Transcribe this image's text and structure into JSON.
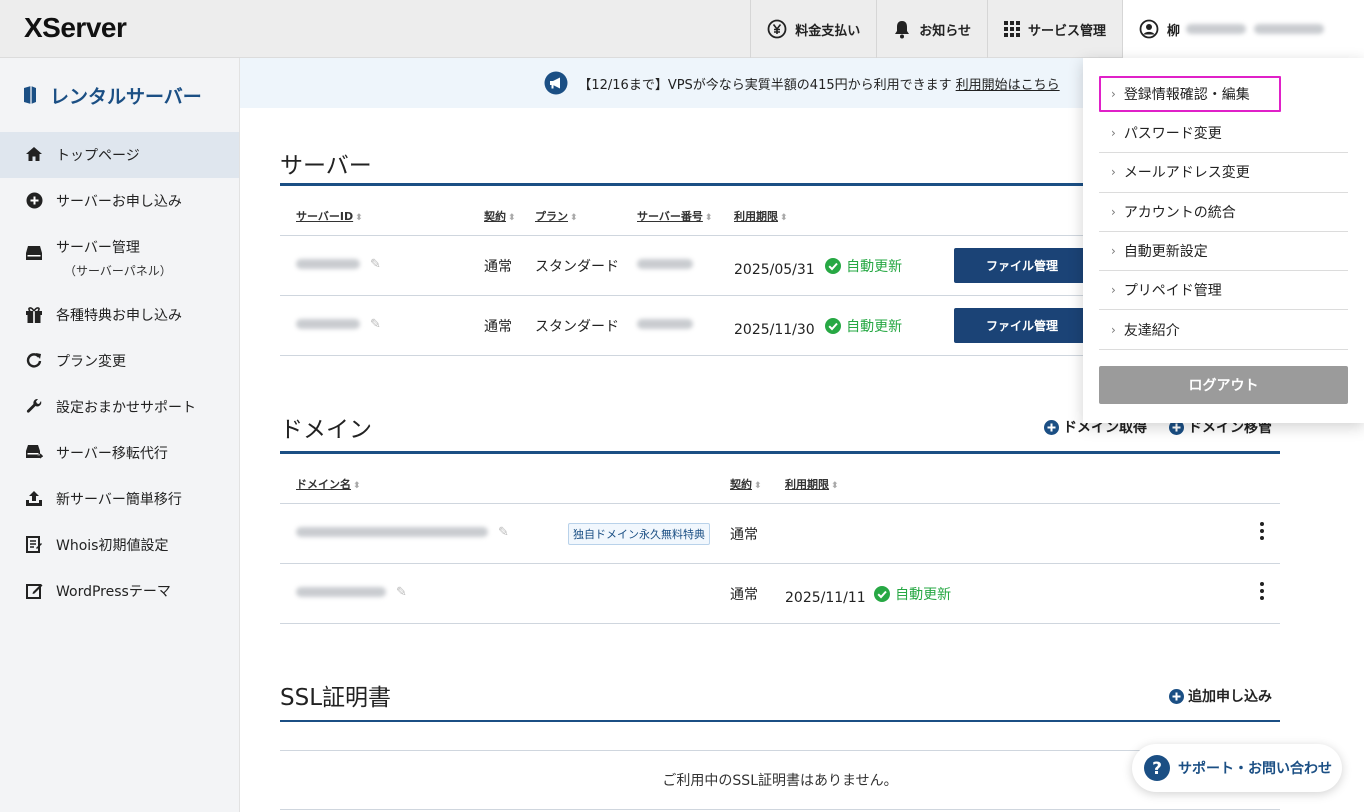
{
  "header": {
    "logo": "XServer",
    "nav": [
      {
        "label": "料金支払い",
        "icon": "yen-icon"
      },
      {
        "label": "お知らせ",
        "icon": "bell-icon"
      },
      {
        "label": "サービス管理",
        "icon": "grid-icon"
      }
    ],
    "user_initial": "柳"
  },
  "sidebar": {
    "title": "レンタルサーバー",
    "items": [
      {
        "label": "トップページ",
        "icon": "home-icon"
      },
      {
        "label": "サーバーお申し込み",
        "icon": "plus-circle-icon"
      },
      {
        "label": "サーバー管理",
        "sub": "（サーバーパネル）",
        "icon": "server-icon"
      },
      {
        "label": "各種特典お申し込み",
        "icon": "gift-icon"
      },
      {
        "label": "プラン変更",
        "icon": "refresh-icon"
      },
      {
        "label": "設定おまかせサポート",
        "icon": "wrench-icon"
      },
      {
        "label": "サーバー移転代行",
        "icon": "server-move-icon"
      },
      {
        "label": "新サーバー簡単移行",
        "icon": "upload-icon"
      },
      {
        "label": "Whois初期値設定",
        "icon": "document-icon"
      },
      {
        "label": "WordPressテーマ",
        "icon": "edit-box-icon"
      }
    ]
  },
  "banner": {
    "text": "【12/16まで】VPSが今なら実質半額の415円から利用できます",
    "link": "利用開始はこちら"
  },
  "server_section": {
    "title": "サーバー",
    "columns": [
      "サーバーID",
      "契約",
      "プラン",
      "サーバー番号",
      "利用期限"
    ],
    "rows": [
      {
        "contract": "通常",
        "plan": "スタンダード",
        "expiry": "2025/05/31",
        "auto": "自動更新",
        "button": "ファイル管理"
      },
      {
        "contract": "通常",
        "plan": "スタンダード",
        "expiry": "2025/11/30",
        "auto": "自動更新",
        "button": "ファイル管理"
      }
    ]
  },
  "domain_section": {
    "title": "ドメイン",
    "actions": [
      "ドメイン取得",
      "ドメイン移管"
    ],
    "columns": [
      "ドメイン名",
      "契約",
      "利用期限"
    ],
    "rows": [
      {
        "tag": "独自ドメイン永久無料特典",
        "contract": "通常",
        "expiry": "",
        "auto": ""
      },
      {
        "tag": "",
        "contract": "通常",
        "expiry": "2025/11/11",
        "auto": "自動更新"
      }
    ]
  },
  "ssl_section": {
    "title": "SSL証明書",
    "action": "追加申し込み",
    "empty": "ご利用中のSSL証明書はありません。"
  },
  "dropdown": {
    "items": [
      "登録情報確認・編集",
      "パスワード変更",
      "メールアドレス変更",
      "アカウントの統合",
      "自動更新設定",
      "プリペイド管理",
      "友達紹介"
    ],
    "logout": "ログアウト"
  },
  "support": {
    "label": "サポート・お問い合わせ"
  },
  "colors": {
    "brand": "#1b4f84",
    "button": "#1b4376",
    "success": "#27a844",
    "highlight": "#e020c8"
  }
}
